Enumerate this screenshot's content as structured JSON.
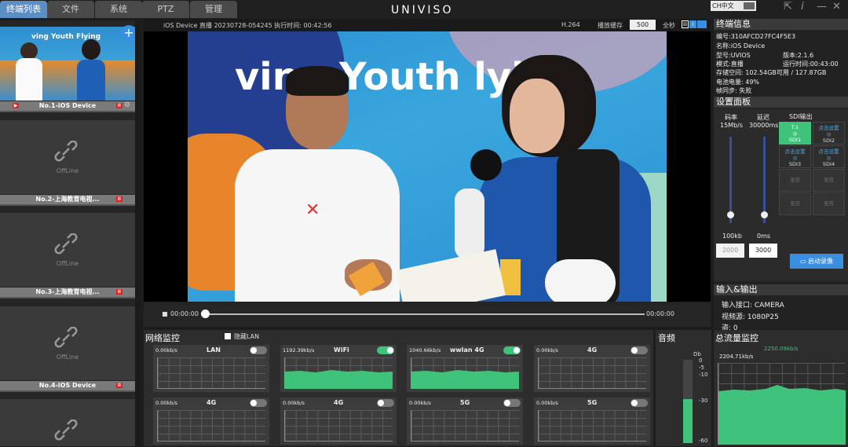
{
  "tabs": [
    "终端列表",
    "文件",
    "系统",
    "PTZ",
    "管理"
  ],
  "logo": "UNIVISO",
  "language": "CH中文",
  "devices": [
    {
      "label": "No.1-iOS Device",
      "status": "online"
    },
    {
      "label": "No.2-上海教育电视...",
      "status": "OffLine"
    },
    {
      "label": "No.3-上海教育电视...",
      "status": "OffLine"
    },
    {
      "label": "No.4-iOS Device",
      "status": "OffLine"
    },
    {
      "label": "",
      "status": ""
    }
  ],
  "offline_text": "OffLine",
  "header": {
    "stream": "iOS Device 直播 20230728-054245 执行时间: 00:42:56",
    "codec": "H.264",
    "buffer_label": "播放缓存",
    "buffer_value": "500",
    "fullscreen": "全秒"
  },
  "video": {
    "banner": "ving Youth  lying"
  },
  "playback": {
    "current": "00:00:00",
    "total": "00:00:00"
  },
  "terminal_info": {
    "title": "终端信息",
    "id": "编号:310AFCD27FC4F5E3",
    "name": "名称:iOS Device",
    "model": "型号:UVIOS",
    "version": "版本:2.1.6",
    "mode": "模式:直播",
    "runtime": "运行时间:00:43:00",
    "storage": "存储空间:  102.54GB可用 / 127.87GB",
    "battery": "电池电量: 49%",
    "sync": "帧同步: 失败"
  },
  "settings": {
    "title": "设置面板",
    "bitrate_label": "码率",
    "bitrate_value": "15Mb/s",
    "bitrate_min": "100kb",
    "bitrate_input": "2000",
    "delay_label": "延迟",
    "delay_value": "30000ms",
    "delay_min": "0ms",
    "delay_input": "3000",
    "bitrate_level": 0.1,
    "delay_level": 0.1,
    "sdi_title": "SDI输出",
    "sdi": [
      {
        "top": "T.1",
        "name": "SDI1",
        "state": "on"
      },
      {
        "top": "点击设置",
        "name": "SDI2",
        "state": "off"
      },
      {
        "top": "点击设置",
        "name": "SDI3",
        "state": "off"
      },
      {
        "top": "点击设置",
        "name": "SDI4",
        "state": "off"
      },
      {
        "top": "无信",
        "name": "",
        "state": "none"
      },
      {
        "top": "无信",
        "name": "",
        "state": "none"
      },
      {
        "top": "无信",
        "name": "",
        "state": "none"
      },
      {
        "top": "无信",
        "name": "",
        "state": "none"
      }
    ],
    "record_button": "启动录像"
  },
  "io": {
    "title": "输入&输出",
    "interface": "输入接口: CAMERA",
    "source": "视频源:   1080P25",
    "extra": "盗: 0"
  },
  "network": {
    "title": "网络监控",
    "hide_lan": "隐藏LAN",
    "cards": [
      {
        "speed": "0.00kb/s",
        "name": "LAN",
        "on": false,
        "graph": false
      },
      {
        "speed": "1192.39kb/s",
        "name": "WiFi",
        "on": true,
        "graph": true
      },
      {
        "speed": "1040.66kb/s",
        "name": "wwlan 4G",
        "on": true,
        "graph": true
      },
      {
        "speed": "0.00kb/s",
        "name": "4G",
        "on": false,
        "graph": false
      },
      {
        "speed": "0.00kb/s",
        "name": "4G",
        "on": false,
        "graph": false
      },
      {
        "speed": "0.00kb/s",
        "name": "4G",
        "on": false,
        "graph": false
      },
      {
        "speed": "0.00kb/s",
        "name": "5G",
        "on": false,
        "graph": false
      },
      {
        "speed": "0.00kb/s",
        "name": "5G",
        "on": false,
        "graph": false
      }
    ]
  },
  "audio": {
    "title": "音频",
    "unit": "Db",
    "ticks": [
      "0",
      "-5",
      "-10",
      "-30",
      "-60"
    ]
  },
  "flow": {
    "title": "总流量监控",
    "peak": "2250.09kb/s",
    "current": "2204.71kb/s"
  }
}
